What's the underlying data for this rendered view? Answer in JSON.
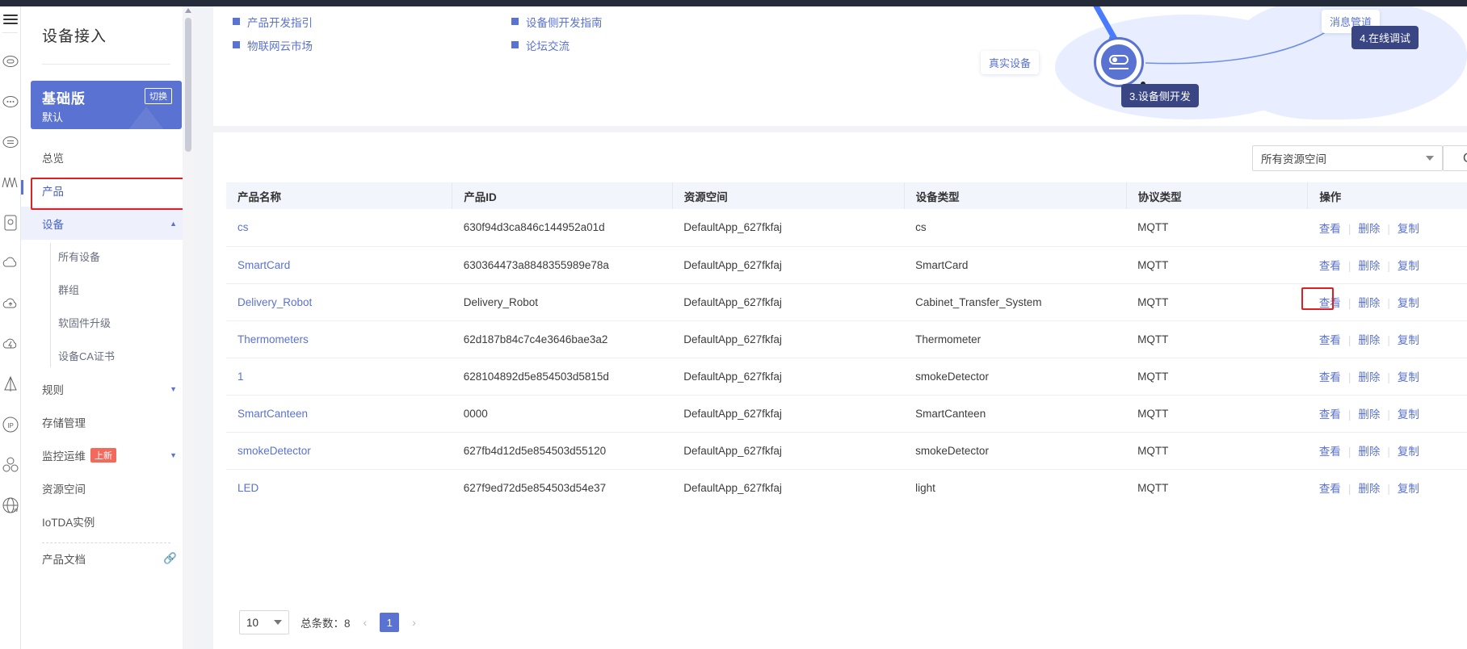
{
  "sidebar": {
    "title": "设备接入",
    "edition": {
      "name": "基础版",
      "sub": "默认",
      "switch_label": "切换"
    },
    "items": [
      {
        "label": "总览"
      },
      {
        "label": "产品"
      },
      {
        "label": "设备"
      },
      {
        "label": "所有设备"
      },
      {
        "label": "群组"
      },
      {
        "label": "软固件升级"
      },
      {
        "label": "设备CA证书"
      },
      {
        "label": "规则"
      },
      {
        "label": "存储管理"
      },
      {
        "label": "监控运维",
        "badge": "上新"
      },
      {
        "label": "资源空间"
      },
      {
        "label": "IoTDA实例"
      },
      {
        "label": "产品文档"
      }
    ]
  },
  "quicklinks": [
    {
      "label": "产品开发指引"
    },
    {
      "label": "设备侧开发指南"
    },
    {
      "label": "物联网云市场"
    },
    {
      "label": "论坛交流"
    }
  ],
  "diagram": {
    "chip_message_channel": "消息管道",
    "chip_real_device": "真实设备",
    "step3": "3.设备侧开发",
    "step4": "4.在线调试"
  },
  "toolbar": {
    "workspace_value": "所有资源空间",
    "refresh_label": "C"
  },
  "table": {
    "columns": [
      "产品名称",
      "产品ID",
      "资源空间",
      "设备类型",
      "协议类型",
      "操作"
    ],
    "actions": {
      "view": "查看",
      "delete": "删除",
      "copy": "复制"
    },
    "rows": [
      {
        "name": "cs",
        "id": "630f94d3ca846c144952a01d",
        "space": "DefaultApp_627fkfaj",
        "device_type": "cs",
        "protocol": "MQTT"
      },
      {
        "name": "SmartCard",
        "id": "630364473a8848355989e78a",
        "space": "DefaultApp_627fkfaj",
        "device_type": "SmartCard",
        "protocol": "MQTT"
      },
      {
        "name": "Delivery_Robot",
        "id": "Delivery_Robot",
        "space": "DefaultApp_627fkfaj",
        "device_type": "Cabinet_Transfer_System",
        "protocol": "MQTT"
      },
      {
        "name": "Thermometers",
        "id": "62d187b84c7c4e3646bae3a2",
        "space": "DefaultApp_627fkfaj",
        "device_type": "Thermometer",
        "protocol": "MQTT"
      },
      {
        "name": "1",
        "id": "628104892d5e854503d5815d",
        "space": "DefaultApp_627fkfaj",
        "device_type": "smokeDetector",
        "protocol": "MQTT"
      },
      {
        "name": "SmartCanteen",
        "id": "0000",
        "space": "DefaultApp_627fkfaj",
        "device_type": "SmartCanteen",
        "protocol": "MQTT"
      },
      {
        "name": "smokeDetector",
        "id": "627fb4d12d5e854503d55120",
        "space": "DefaultApp_627fkfaj",
        "device_type": "smokeDetector",
        "protocol": "MQTT"
      },
      {
        "name": "LED",
        "id": "627f9ed72d5e854503d54e37",
        "space": "DefaultApp_627fkfaj",
        "device_type": "light",
        "protocol": "MQTT"
      }
    ]
  },
  "pagination": {
    "page_size": "10",
    "total_label": "总条数：8",
    "prev": "‹",
    "next": "›",
    "current_page": "1"
  },
  "colors": {
    "accent": "#5a72d1",
    "highlight": "#e02020",
    "badge": "#f3695c"
  }
}
